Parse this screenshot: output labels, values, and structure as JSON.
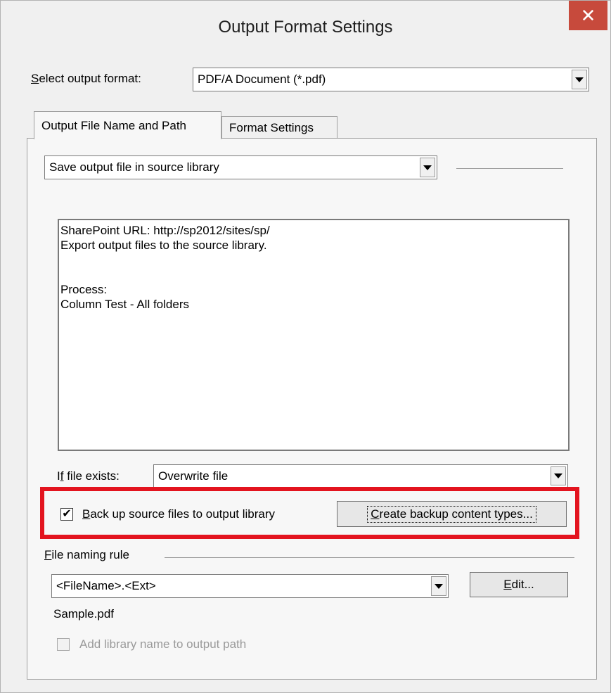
{
  "window": {
    "title": "Output Format Settings",
    "close_icon": "close-icon"
  },
  "output_format": {
    "label_prefix": "S",
    "label_rest": "elect output format:",
    "value": "PDF/A Document (*.pdf)"
  },
  "tabs": [
    {
      "label": "Output File Name and Path",
      "active": true
    },
    {
      "label": "Format Settings",
      "active": false
    }
  ],
  "save_location": {
    "value": "Save output file in source library"
  },
  "info_lines": [
    "SharePoint URL: http://sp2012/sites/sp/",
    "Export output files to the source library.",
    "",
    "",
    "Process:",
    "Column Test - All folders"
  ],
  "if_file_exists": {
    "label_pre": "I",
    "label_u": "f",
    "label_rest": " file exists:",
    "value": "Overwrite file"
  },
  "backup": {
    "checked": true,
    "label_u": "B",
    "label_rest": "ack up source files to output library",
    "button_u": "C",
    "button_rest": "reate backup content types..."
  },
  "file_naming": {
    "label_u": "F",
    "label_rest": "ile naming rule",
    "value": "<FileName>.<Ext>",
    "edit_u": "E",
    "edit_rest": "dit...",
    "sample": "Sample.pdf"
  },
  "add_library": {
    "checked": false,
    "label": "Add library name to output path"
  },
  "colors": {
    "close_button": "#c74a3c",
    "highlight_border": "#e3141f",
    "dialog_bg": "#f0f0f0"
  }
}
